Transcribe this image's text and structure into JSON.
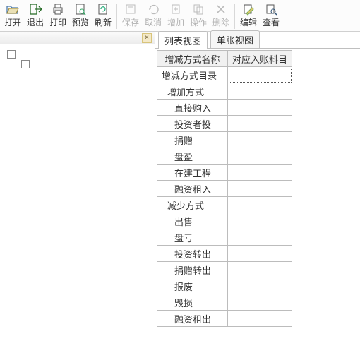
{
  "toolbar": {
    "open": {
      "label": "打开",
      "enabled": true,
      "icon": "folder-open-icon"
    },
    "exit": {
      "label": "退出",
      "enabled": true,
      "icon": "exit-icon"
    },
    "print": {
      "label": "打印",
      "enabled": true,
      "icon": "printer-icon"
    },
    "preview": {
      "label": "预览",
      "enabled": true,
      "icon": "preview-icon"
    },
    "refresh": {
      "label": "刷新",
      "enabled": true,
      "icon": "refresh-icon"
    },
    "save": {
      "label": "保存",
      "enabled": false,
      "icon": "save-icon"
    },
    "cancel": {
      "label": "取消",
      "enabled": false,
      "icon": "cancel-icon"
    },
    "add": {
      "label": "增加",
      "enabled": false,
      "icon": "add-icon"
    },
    "op": {
      "label": "操作",
      "enabled": false,
      "icon": "op-icon"
    },
    "delete": {
      "label": "删除",
      "enabled": false,
      "icon": "delete-icon"
    },
    "edit": {
      "label": "编辑",
      "enabled": true,
      "icon": "edit-icon"
    },
    "view": {
      "label": "查看",
      "enabled": true,
      "icon": "view-icon"
    }
  },
  "left_pane": {
    "close_glyph": "×"
  },
  "tabs": {
    "list": {
      "label": "列表视图",
      "active": true
    },
    "single": {
      "label": "单张视图",
      "active": false
    }
  },
  "grid": {
    "columns": [
      "增减方式名称",
      "对应入账科目"
    ],
    "selected_row": 0,
    "selected_col": 1,
    "rows": [
      {
        "name": "增减方式目录",
        "account": "",
        "indent": 0
      },
      {
        "name": "增加方式",
        "account": "",
        "indent": 1
      },
      {
        "name": "直接购入",
        "account": "",
        "indent": 2
      },
      {
        "name": "投资者投",
        "account": "",
        "indent": 2
      },
      {
        "name": "捐赠",
        "account": "",
        "indent": 2
      },
      {
        "name": "盘盈",
        "account": "",
        "indent": 2
      },
      {
        "name": "在建工程",
        "account": "",
        "indent": 2
      },
      {
        "name": "融资租入",
        "account": "",
        "indent": 2
      },
      {
        "name": "减少方式",
        "account": "",
        "indent": 1
      },
      {
        "name": "出售",
        "account": "",
        "indent": 2
      },
      {
        "name": "盘亏",
        "account": "",
        "indent": 2
      },
      {
        "name": "投资转出",
        "account": "",
        "indent": 2
      },
      {
        "name": "捐赠转出",
        "account": "",
        "indent": 2
      },
      {
        "name": "报废",
        "account": "",
        "indent": 2
      },
      {
        "name": "毁损",
        "account": "",
        "indent": 2
      },
      {
        "name": "融资租出",
        "account": "",
        "indent": 2
      }
    ]
  }
}
